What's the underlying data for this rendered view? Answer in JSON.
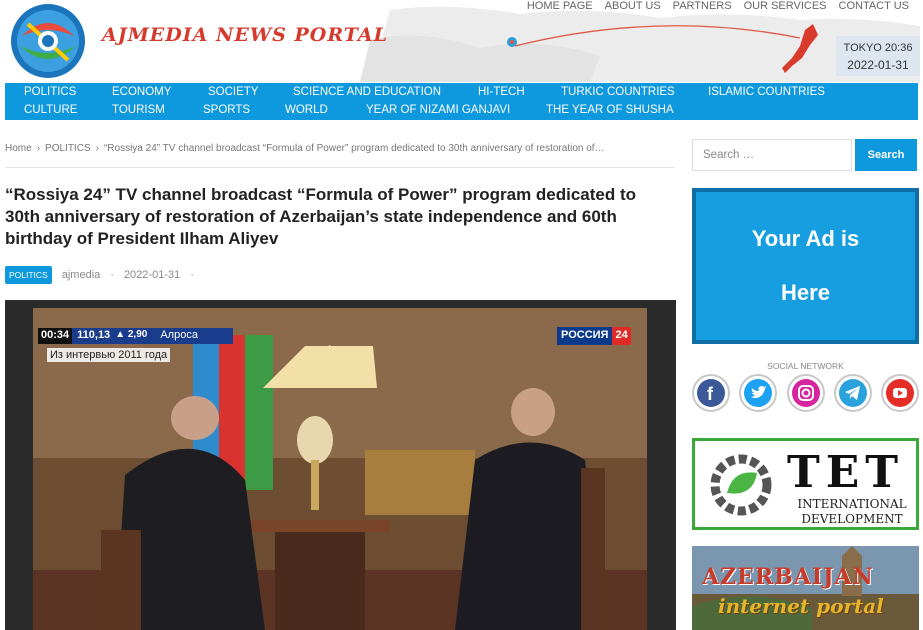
{
  "header": {
    "site_title": "AJMEDIA NEWS PORTAL",
    "top_nav": [
      "HOME PAGE",
      "ABOUT US",
      "PARTNERS",
      "OUR SERVICES",
      "CONTACT US"
    ],
    "clock_city_time": "TOKYO 20:36",
    "clock_date": "2022-01-31"
  },
  "main_nav": {
    "row1": [
      "POLITICS",
      "ECONOMY",
      "SOCIETY",
      "SCIENCE AND EDUCATION",
      "HI-TECH",
      "TURKIC COUNTRIES",
      "ISLAMIC COUNTRIES"
    ],
    "row2": [
      "CULTURE",
      "TOURISM",
      "SPORTS",
      "WORLD",
      "YEAR OF NIZAMI GANJAVI",
      "THE YEAR OF SHUSHA"
    ]
  },
  "breadcrumb": {
    "home": "Home",
    "category": "POLITICS",
    "current": "“Rossiya 24” TV channel broadcast “Formula of Power” program dedicated to 30th anniversary of restoration of…"
  },
  "article": {
    "title": "“Rossiya 24” TV channel broadcast “Formula of Power” program dedicated to 30th anniversary of restoration of Azerbaijan’s state independence and 60th birthday of President Ilham Aliyev",
    "category_badge": "POLITICS",
    "author": "ajmedia",
    "date": "2022-01-31",
    "meta_sep": "·"
  },
  "video_overlay": {
    "time": "00:34",
    "ticker_value": "110,13",
    "ticker_change": "▲ 2,90",
    "ticker_name": "Алроса",
    "channel_name": "РОССИЯ",
    "channel_number": "24",
    "caption": "Из интервью 2011 года"
  },
  "sidebar": {
    "search_placeholder": "Search …",
    "search_button": "Search",
    "ad_line1": "Your Ad is",
    "ad_line2": "Here",
    "social_title": "SOCIAL NETWORK",
    "social_icons": [
      "facebook-icon",
      "twitter-icon",
      "instagram-icon",
      "telegram-icon",
      "youtube-icon"
    ],
    "tet_letters": "TET",
    "tet_sub1": "INTERNATIONAL",
    "tet_sub2": "DEVELOPMENT",
    "az_title": "AZERBAIJAN",
    "az_sub": "internet portal"
  },
  "colors": {
    "accent": "#0e98dd",
    "title_red": "#d63a2c",
    "tet_green": "#3aa93a"
  }
}
